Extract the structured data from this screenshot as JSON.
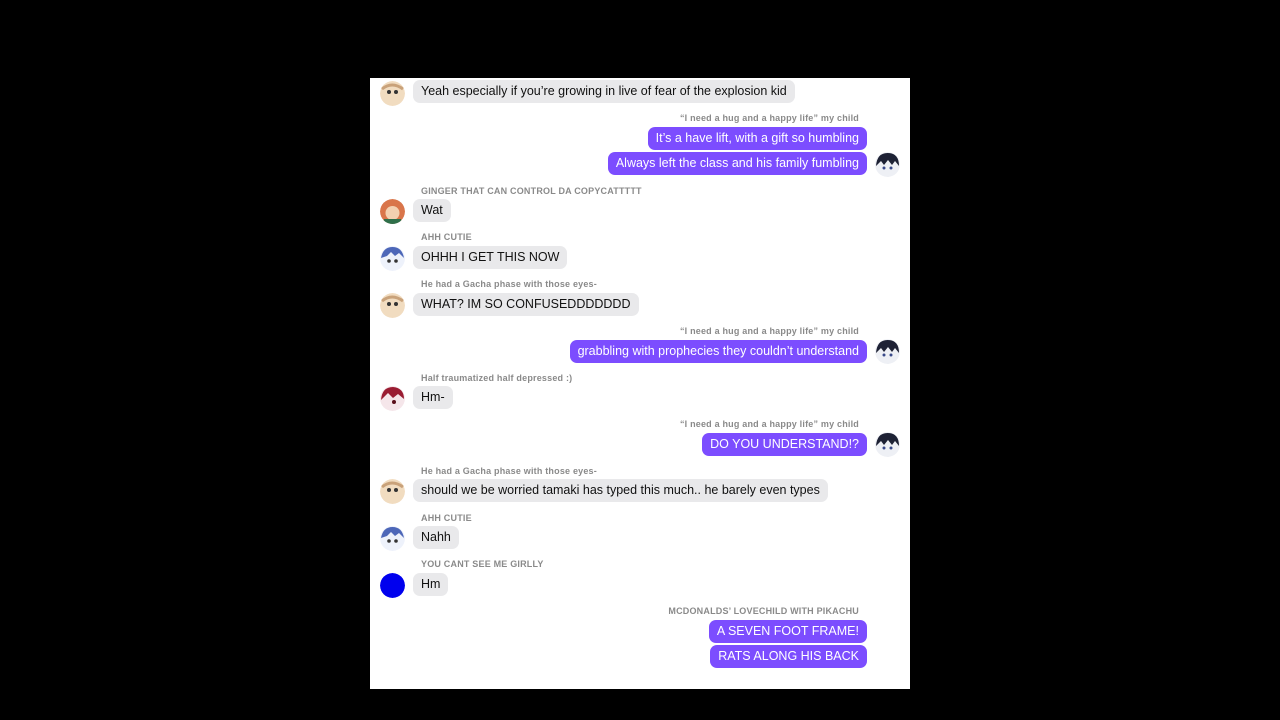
{
  "messages": [
    {
      "side": "in",
      "sender": "",
      "text": "Yeah especially if you’re growing in live of fear of the explosion kid",
      "avatar": "beige-face-icon"
    },
    {
      "side": "out",
      "sender": "“I need a hug and a happy life” my child",
      "text": "It’s a have lift, with a gift so humbling"
    },
    {
      "side": "out",
      "sender": "",
      "text": "Always left the class and his family fumbling",
      "avatar": "dark-hair-icon"
    },
    {
      "side": "in",
      "sender": "GINGER THAT CAN CONTROL DA COPYCATTTTT",
      "text": "Wat",
      "avatar": "ginger-icon"
    },
    {
      "side": "in",
      "sender": "AHH CUTIE",
      "text": "OHHH I GET THIS NOW",
      "avatar": "blue-hair-icon"
    },
    {
      "side": "in",
      "sender": "He had a Gacha phase with those eyes-",
      "text": "WHAT? IM SO CONFUSEDDDDDDD",
      "avatar": "beige-face-icon"
    },
    {
      "side": "out",
      "sender": "“I need a hug and a happy life” my child",
      "text": "grabbling with prophecies they couldn’t understand",
      "avatar": "dark-hair-icon"
    },
    {
      "side": "in",
      "sender": "Half traumatized half depressed :)",
      "text": "Hm-",
      "avatar": "red-hair-icon"
    },
    {
      "side": "out",
      "sender": "“I need a hug and a happy life” my child",
      "text": "DO YOU UNDERSTAND!?",
      "avatar": "dark-hair-icon"
    },
    {
      "side": "in",
      "sender": "He had a Gacha phase with those eyes-",
      "text": "should we be worried tamaki has typed this much.. he barely even types",
      "avatar": "beige-face-icon"
    },
    {
      "side": "in",
      "sender": "AHH CUTIE",
      "text": "Nahh",
      "avatar": "blue-hair-icon"
    },
    {
      "side": "in",
      "sender": "YOU CANT SEE ME GIRLLY",
      "text": "Hm",
      "avatar": "blue-circle-icon"
    },
    {
      "side": "out",
      "sender": "MCDONALDS’ LOVECHILD WITH PIKACHU",
      "text": "A SEVEN FOOT FRAME!"
    },
    {
      "side": "out",
      "sender": "",
      "text": "RATS ALONG HIS BACK"
    }
  ],
  "colors": {
    "outgoing": "#7c4dff",
    "incoming": "#e9e9eb"
  }
}
